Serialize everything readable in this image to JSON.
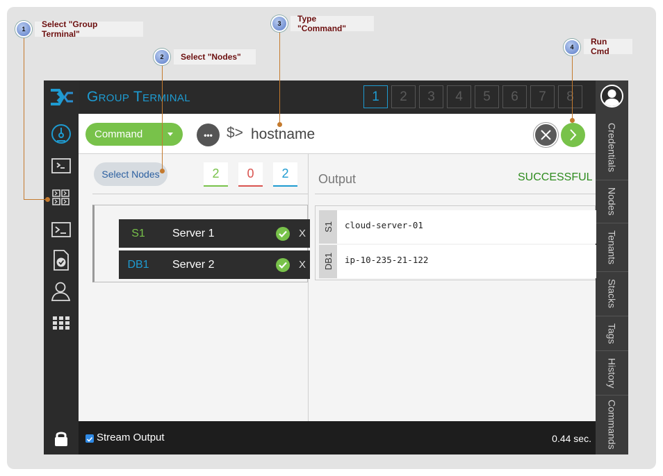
{
  "annotations": [
    {
      "step": "1",
      "label": "Select \"Group Terminal\""
    },
    {
      "step": "2",
      "label": "Select \"Nodes\""
    },
    {
      "step": "3",
      "label": "Type \"Command\""
    },
    {
      "step": "4",
      "label": "Run Cmd"
    }
  ],
  "header": {
    "title": "Group Terminal",
    "terminal_tabs": [
      "1",
      "2",
      "3",
      "4",
      "5",
      "6",
      "7",
      "8"
    ],
    "active_tab": "1"
  },
  "command_bar": {
    "type_select": "Command",
    "prompt": "$>",
    "command": "hostname"
  },
  "nodes": {
    "select_button": "Select Nodes",
    "counts": {
      "success": "2",
      "failed": "0",
      "total": "2"
    },
    "rows": [
      {
        "id": "S1",
        "name": "Server 1",
        "id_color": "#78c24a",
        "remove": "X"
      },
      {
        "id": "DB1",
        "name": "Server 2",
        "id_color": "#1e9bd1",
        "remove": "X"
      }
    ]
  },
  "output": {
    "label": "Output",
    "status": "SUCCESSFUL",
    "rows": [
      {
        "node": "S1",
        "text": "cloud-server-01"
      },
      {
        "node": "DB1",
        "text": "ip-10-235-21-122"
      }
    ]
  },
  "right_tabs": [
    "Credentials",
    "Nodes",
    "Tenants",
    "Stacks",
    "Tags",
    "History",
    "Commands"
  ],
  "footer": {
    "stream_output": "Stream Output",
    "elapsed": "0.44 sec."
  },
  "colors": {
    "accent": "#1e9bd1",
    "success": "#78c24a",
    "error": "#d9534f",
    "annotation": "#c47a2e"
  }
}
